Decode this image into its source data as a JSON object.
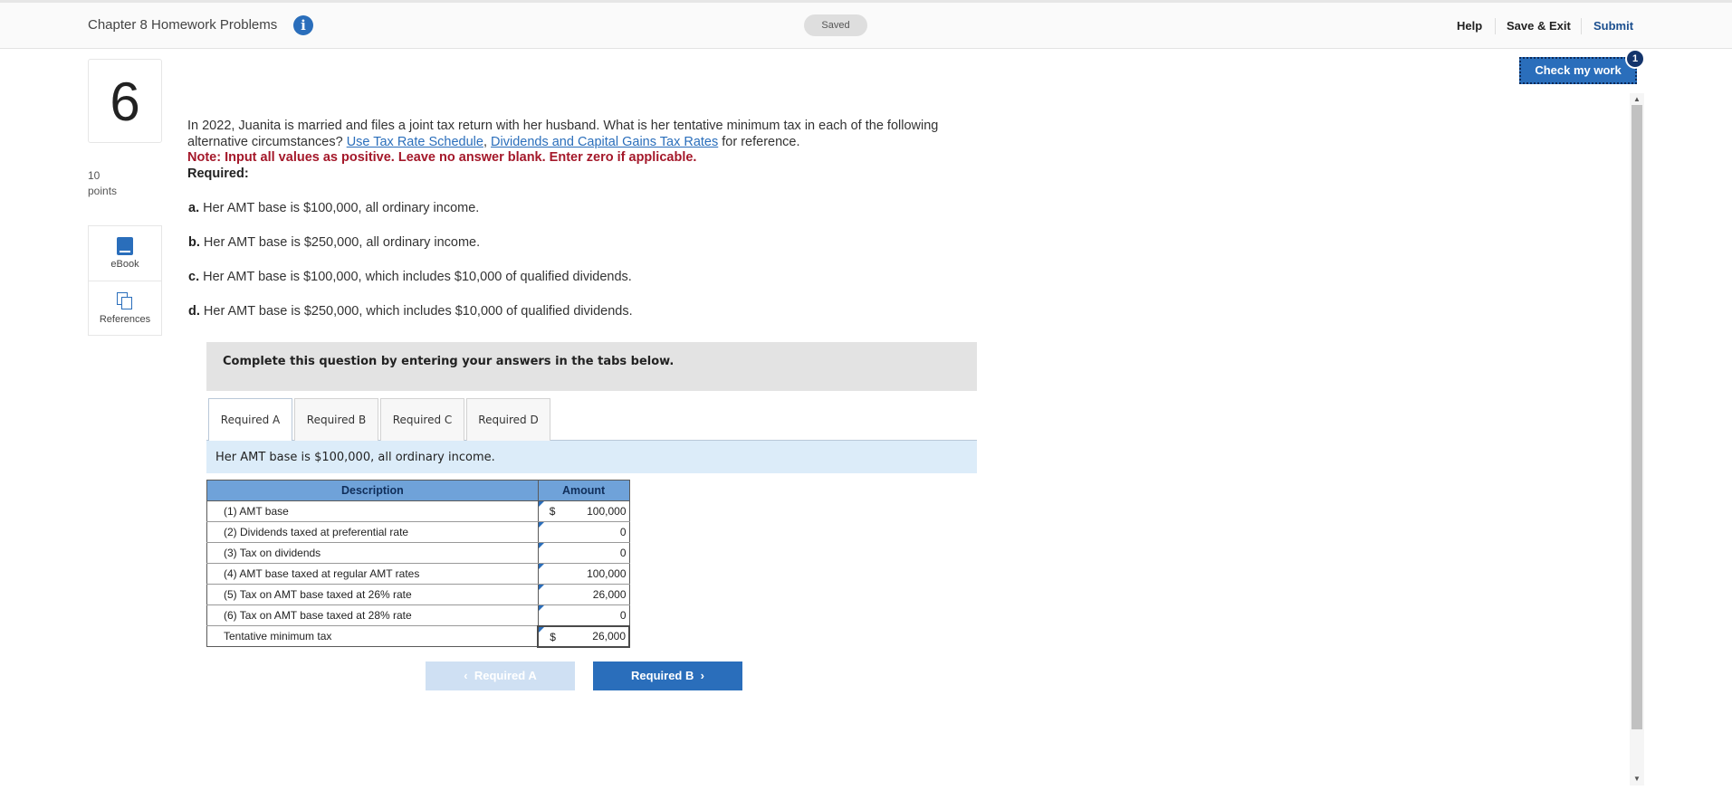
{
  "header": {
    "title": "Chapter 8 Homework Problems",
    "status": "Saved",
    "help": "Help",
    "save_exit": "Save & Exit",
    "submit": "Submit"
  },
  "check_work": {
    "label": "Check my work",
    "badge": "1"
  },
  "question": {
    "number": "6",
    "points_value": "10",
    "points_label": "points",
    "tools": [
      "eBook",
      "References"
    ],
    "prompt_before": "In 2022, Juanita is married and files a joint tax return with her husband. What is her tentative minimum tax in each of the following alternative circumstances? ",
    "link1": "Use Tax Rate Schedule",
    "comma": ", ",
    "link2": "Dividends and Capital Gains Tax Rates",
    "prompt_after": " for reference.",
    "note": "Note: Input all values as positive. Leave no answer blank. Enter zero if applicable.",
    "required_label": "Required:",
    "parts": [
      {
        "letter": "a.",
        "text": "Her AMT base is $100,000, all ordinary income."
      },
      {
        "letter": "b.",
        "text": "Her AMT base is $250,000, all ordinary income."
      },
      {
        "letter": "c.",
        "text": "Her AMT base is $100,000, which includes $10,000 of qualified dividends."
      },
      {
        "letter": "d.",
        "text": "Her AMT base is $250,000, which includes $10,000 of qualified dividends."
      }
    ]
  },
  "instructions": "Complete this question by entering your answers in the tabs below.",
  "tabs": [
    "Required A",
    "Required B",
    "Required C",
    "Required D"
  ],
  "active_tab": "Required A",
  "panel_text": "Her AMT base is $100,000, all ordinary income.",
  "table": {
    "headers": [
      "Description",
      "Amount"
    ],
    "rows": [
      {
        "desc": "(1) AMT base",
        "currency": "$",
        "amount": "100,000"
      },
      {
        "desc": "(2) Dividends taxed at preferential rate",
        "currency": "",
        "amount": "0"
      },
      {
        "desc": "(3) Tax on dividends",
        "currency": "",
        "amount": "0"
      },
      {
        "desc": "(4) AMT base taxed at regular AMT rates",
        "currency": "",
        "amount": "100,000"
      },
      {
        "desc": "(5) Tax on AMT base taxed at 26% rate",
        "currency": "",
        "amount": "26,000"
      },
      {
        "desc": "(6) Tax on AMT base taxed at 28% rate",
        "currency": "",
        "amount": "0"
      },
      {
        "desc": "Tentative minimum tax",
        "currency": "$",
        "amount": "26,000"
      }
    ]
  },
  "nav": {
    "prev": "Required A",
    "next": "Required B"
  },
  "colors": {
    "accent": "#2a6ebb",
    "note_red": "#a4182a",
    "table_header": "#6fa2d9"
  }
}
